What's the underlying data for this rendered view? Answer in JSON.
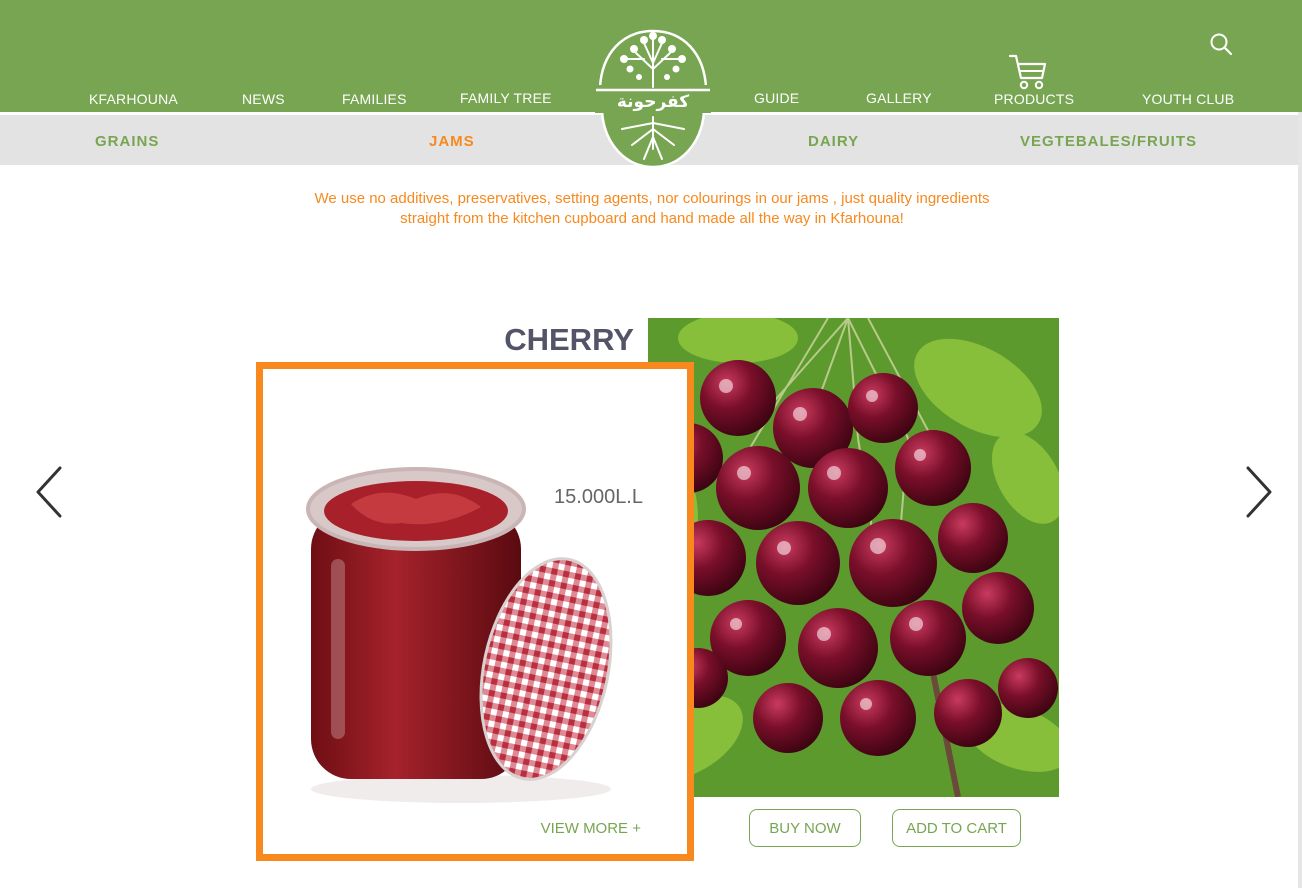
{
  "header": {
    "nav_left": [
      "KFARHOUNA",
      "NEWS",
      "FAMILIES",
      "FAMILY TREE"
    ],
    "nav_right": [
      "GUIDE",
      "GALLERY",
      "PRODUCTS",
      "YOUTH CLUB"
    ],
    "logo_text": "كفرحونة",
    "icons": {
      "search": "search-icon",
      "cart": "cart-icon"
    }
  },
  "categories": [
    {
      "label": "GRAINS",
      "active": false
    },
    {
      "label": "JAMS",
      "active": true
    },
    {
      "label": "DAIRY",
      "active": false
    },
    {
      "label": "VEGTEBALES/FRUITS",
      "active": false
    }
  ],
  "intro_text": "We use no additives, preservatives, setting agents, nor colourings in our jams , just quality ingredients straight from the kitchen cupboard and hand made all the way in Kfarhouna!",
  "product": {
    "name": "CHERRY",
    "price": "15.000L.L",
    "view_more": "VIEW MORE +",
    "buy_now": "BUY NOW",
    "add_to_cart": "ADD TO CART"
  },
  "carousel": {
    "prev_icon": "chevron-left-icon",
    "next_icon": "chevron-right-icon"
  },
  "colors": {
    "brand_green": "#78a552",
    "accent_orange": "#f7891e",
    "subnav_bg": "#e3e3e3",
    "title_gray": "#545468"
  }
}
